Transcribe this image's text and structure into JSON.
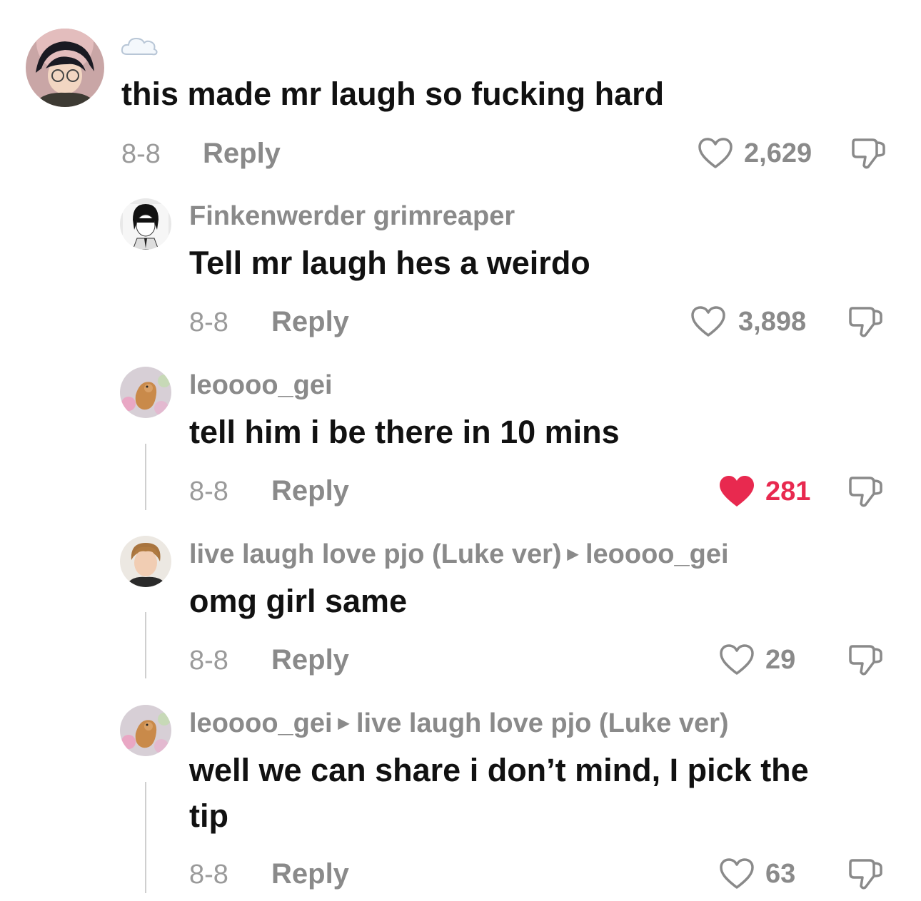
{
  "comments": [
    {
      "username": "",
      "status_icon": "cloud-emoji",
      "text": "this made mr laugh so fucking hard",
      "date": "8-8",
      "reply_label": "Reply",
      "likes": "2,629",
      "liked": false
    },
    {
      "username": "Finkenwerder grimreaper",
      "text": "Tell mr laugh hes a weirdo",
      "date": "8-8",
      "reply_label": "Reply",
      "likes": "3,898",
      "liked": false
    },
    {
      "username": "leoooo_gei",
      "text": "tell him i be there in 10 mins",
      "date": "8-8",
      "reply_label": "Reply",
      "likes": "281",
      "liked": true
    },
    {
      "username": "live laugh love pjo (Luke ver)",
      "reply_to": "leoooo_gei",
      "text": "omg girl same",
      "date": "8-8",
      "reply_label": "Reply",
      "likes": "29",
      "liked": false
    },
    {
      "username": "leoooo_gei",
      "reply_to": "live laugh love pjo (Luke ver)",
      "text_line1": "well we can share i don’t mind, I pick the",
      "text_line2": "tip",
      "date": "8-8",
      "reply_label": "Reply",
      "likes": "63",
      "liked": false
    }
  ],
  "colors": {
    "liked_heart": "#e8294f",
    "meta_gray": "#8a8a8a",
    "thread_line": "#cfcfcf"
  }
}
